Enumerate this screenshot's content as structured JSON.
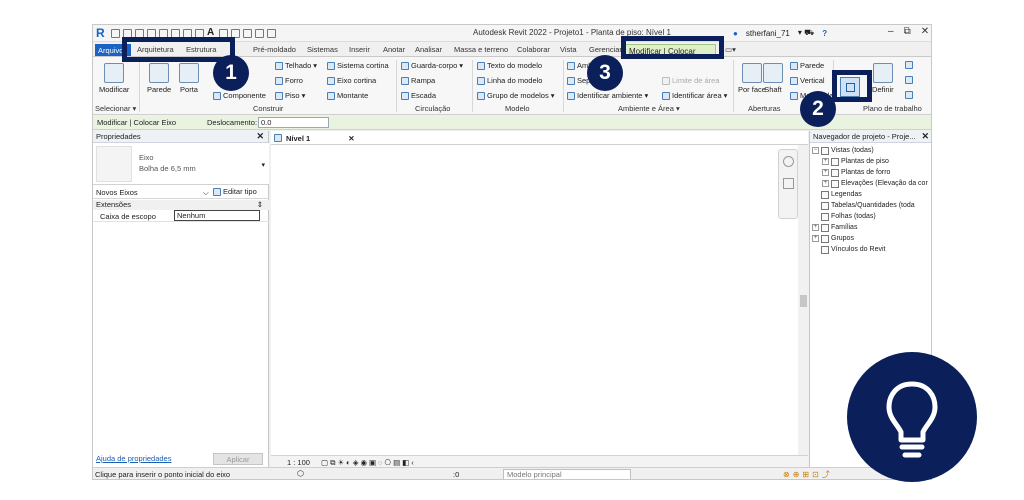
{
  "app": {
    "logo": "R",
    "window_title": "Autodesk Revit 2022 - Projeto1 - Planta de piso: Nível 1",
    "user": "stherfani_71",
    "help": "?",
    "controls": [
      "–",
      "⧉",
      "✕"
    ]
  },
  "tabs": {
    "file": "Arquivo",
    "items": [
      "Arquitetura",
      "Estrutura",
      "Pré-moldado",
      "Sistemas",
      "Inserir",
      "Anotar",
      "Analisar",
      "Massa e terreno",
      "Colaborar",
      "Vista",
      "Gerenciar"
    ],
    "contextual": "Modificar | Colocar Eixo"
  },
  "ribbon": {
    "modificar": "Modificar",
    "parede": "Parede",
    "porta": "Porta",
    "componente": "Componente",
    "telhado": "Telhado",
    "forro": "Forro",
    "piso": "Piso",
    "sistema_cortina": "Sistema cortina",
    "eixo_cortina": "Eixo cortina",
    "montante": "Montante",
    "guarda_corpo": "Guarda-corpo",
    "rampa": "Rampa",
    "escada": "Escada",
    "texto_modelo": "Texto do modelo",
    "linha_modelo": "Linha do modelo",
    "grupo_modelos": "Grupo de modelos",
    "ambiente": "Ambiente",
    "separador": "Separador",
    "identificar_ambiente": "Identificar ambiente",
    "limite_area": "Limite de área",
    "identificar_area": "Identificar área",
    "por_face": "Por face",
    "shaft": "Shaft",
    "parede_open": "Parede",
    "vertical": "Vertical",
    "mansarda": "Mansarda",
    "definir": "Definir",
    "groups": {
      "selecionar": "Selecionar",
      "construir": "Construir",
      "circulacao": "Circulação",
      "modelo": "Modelo",
      "ambiente_area": "Ambiente e Área",
      "aberturas": "Aberturas",
      "plano": "Plano de trabalho"
    }
  },
  "options": {
    "context": "Modificar | Colocar Eixo",
    "offset_label": "Deslocamento:",
    "offset_value": "0.0"
  },
  "properties": {
    "title": "Propriedades",
    "type_family": "Eixo",
    "type_name": "Bolha de 6,5 mm",
    "selector": "Novos Eixos",
    "edit_type": "Editar tipo",
    "section": "Extensões",
    "prop_name": "Caixa de escopo",
    "prop_value": "Nenhum",
    "help": "Ajuda de propriedades",
    "apply": "Aplicar"
  },
  "view": {
    "tab": "Nível 1",
    "scale": "1 : 100"
  },
  "browser": {
    "title": "Navegador de projeto - Proje...",
    "items": [
      {
        "label": "Vistas (todas)",
        "level": 0,
        "toggle": "−"
      },
      {
        "label": "Plantas de piso",
        "level": 1,
        "toggle": "+"
      },
      {
        "label": "Plantas de forro",
        "level": 1,
        "toggle": "+"
      },
      {
        "label": "Elevações (Elevação da cor",
        "level": 1,
        "toggle": "+"
      },
      {
        "label": "Legendas",
        "level": 0,
        "toggle": ""
      },
      {
        "label": "Tabelas/Quantidades (toda",
        "level": 0,
        "toggle": ""
      },
      {
        "label": "Folhas (todas)",
        "level": 0,
        "toggle": ""
      },
      {
        "label": "Famílias",
        "level": 0,
        "toggle": "+"
      },
      {
        "label": "Grupos",
        "level": 0,
        "toggle": "+"
      },
      {
        "label": "Vínculos do Revit",
        "level": 0,
        "toggle": ""
      }
    ]
  },
  "status": {
    "message": "Clique para inserir o ponto inicial do eixo",
    "zero": ":0",
    "model": "Modelo principal"
  },
  "callouts": {
    "one": "1",
    "two": "2",
    "three": "3"
  },
  "colors": {
    "callout": "#0b1f5a",
    "file_tab": "#1a63c4",
    "contextual_tab": "#dff0c8"
  }
}
